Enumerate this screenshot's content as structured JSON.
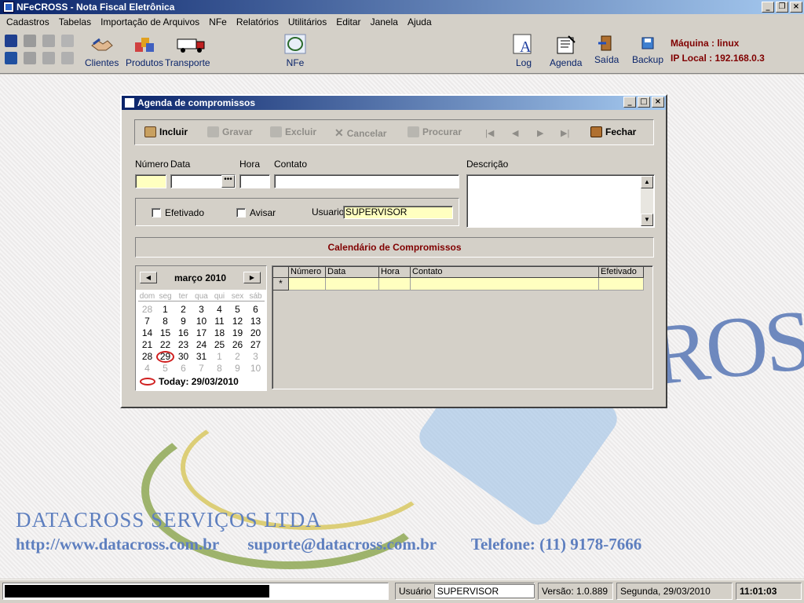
{
  "app": {
    "title": "NFeCROSS - Nota Fiscal Eletrônica"
  },
  "menu": [
    "Cadastros",
    "Tabelas",
    "Importação de Arquivos",
    "NFe",
    "Relatórios",
    "Utilitários",
    "Editar",
    "Janela",
    "Ajuda"
  ],
  "toolbar": {
    "clientes": "Clientes",
    "produtos": "Produtos",
    "transporte": "Transporte",
    "nfe": "NFe",
    "log": "Log",
    "agenda": "Agenda",
    "saida": "Saída",
    "backup": "Backup"
  },
  "machine": {
    "name": "Máquina : linux",
    "ip": "IP Local : 192.168.0.3"
  },
  "background": {
    "company": "DATACROSS SERVIÇOS LTDA",
    "url": "http://www.datacross.com.br",
    "email": "suporte@datacross.com.br",
    "phone": "Telefone: (11) 9178-7666",
    "logo_text": "CROSS"
  },
  "dialog": {
    "title": "Agenda de compromissos",
    "buttons": {
      "incluir": "Incluir",
      "gravar": "Gravar",
      "excluir": "Excluir",
      "cancelar": "Cancelar",
      "procurar": "Procurar",
      "fechar": "Fechar"
    },
    "labels": {
      "numero": "Número",
      "data": "Data",
      "hora": "Hora",
      "contato": "Contato",
      "descricao": "Descrição",
      "efetivado": "Efetivado",
      "avisar": "Avisar",
      "usuario": "Usuario"
    },
    "fields": {
      "numero": "",
      "data": "",
      "hora": "",
      "contato": "",
      "usuario": "SUPERVISOR",
      "descricao": ""
    },
    "calendar_title": "Calendário de Compromissos",
    "calendar": {
      "month": "março 2010",
      "dow": [
        "dom",
        "seg",
        "ter",
        "qua",
        "qui",
        "sex",
        "sáb"
      ],
      "today_label": "Today: 29/03/2010"
    },
    "grid_columns": [
      "Número",
      "Data",
      "Hora",
      "Contato",
      "Efetivado"
    ],
    "new_row_marker": "*"
  },
  "status": {
    "usuario_label": "Usuário",
    "usuario": "SUPERVISOR",
    "versao": "Versão: 1.0.889",
    "date": "Segunda, 29/03/2010",
    "time": "11:01:03",
    "progress": 0.69
  },
  "colors": {
    "title_bar": "#0a246a",
    "accent_red": "#800000",
    "highlight_yellow": "#ffffc0"
  }
}
